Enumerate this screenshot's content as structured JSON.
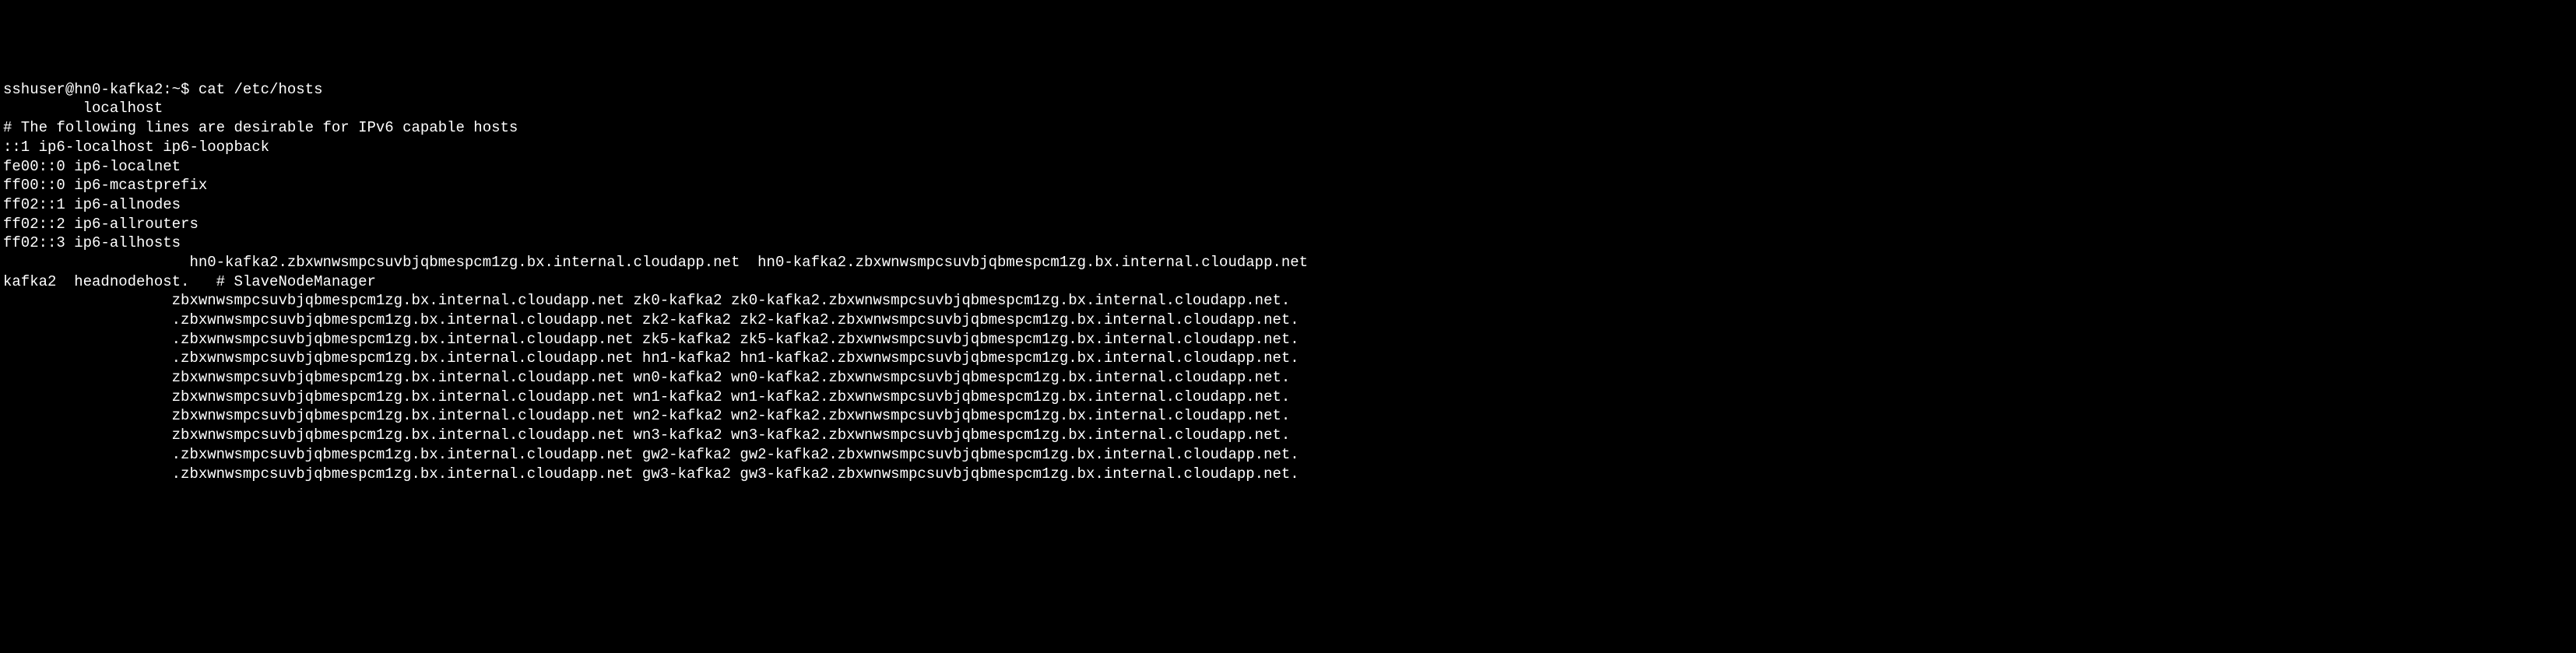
{
  "terminal": {
    "prompt": "sshuser@hn0-kafka2:~$ cat /etc/hosts",
    "lines": [
      "sshuser@hn0-kafka2:~$ cat /etc/hosts",
      "         localhost",
      "",
      "# The following lines are desirable for IPv6 capable hosts",
      "::1 ip6-localhost ip6-loopback",
      "fe00::0 ip6-localnet",
      "ff00::0 ip6-mcastprefix",
      "ff02::1 ip6-allnodes",
      "ff02::2 ip6-allrouters",
      "ff02::3 ip6-allhosts",
      "                     hn0-kafka2.zbxwnwsmpcsuvbjqbmespcm1zg.bx.internal.cloudapp.net  hn0-kafka2.zbxwnwsmpcsuvbjqbmespcm1zg.bx.internal.cloudapp.net",
      "kafka2  headnodehost.   # SlaveNodeManager",
      "                   zbxwnwsmpcsuvbjqbmespcm1zg.bx.internal.cloudapp.net zk0-kafka2 zk0-kafka2.zbxwnwsmpcsuvbjqbmespcm1zg.bx.internal.cloudapp.net.",
      "                   .zbxwnwsmpcsuvbjqbmespcm1zg.bx.internal.cloudapp.net zk2-kafka2 zk2-kafka2.zbxwnwsmpcsuvbjqbmespcm1zg.bx.internal.cloudapp.net.",
      "                   .zbxwnwsmpcsuvbjqbmespcm1zg.bx.internal.cloudapp.net zk5-kafka2 zk5-kafka2.zbxwnwsmpcsuvbjqbmespcm1zg.bx.internal.cloudapp.net.",
      "                   .zbxwnwsmpcsuvbjqbmespcm1zg.bx.internal.cloudapp.net hn1-kafka2 hn1-kafka2.zbxwnwsmpcsuvbjqbmespcm1zg.bx.internal.cloudapp.net.",
      "                   zbxwnwsmpcsuvbjqbmespcm1zg.bx.internal.cloudapp.net wn0-kafka2 wn0-kafka2.zbxwnwsmpcsuvbjqbmespcm1zg.bx.internal.cloudapp.net.",
      "                   zbxwnwsmpcsuvbjqbmespcm1zg.bx.internal.cloudapp.net wn1-kafka2 wn1-kafka2.zbxwnwsmpcsuvbjqbmespcm1zg.bx.internal.cloudapp.net.",
      "                   zbxwnwsmpcsuvbjqbmespcm1zg.bx.internal.cloudapp.net wn2-kafka2 wn2-kafka2.zbxwnwsmpcsuvbjqbmespcm1zg.bx.internal.cloudapp.net.",
      "                   zbxwnwsmpcsuvbjqbmespcm1zg.bx.internal.cloudapp.net wn3-kafka2 wn3-kafka2.zbxwnwsmpcsuvbjqbmespcm1zg.bx.internal.cloudapp.net.",
      "                   .zbxwnwsmpcsuvbjqbmespcm1zg.bx.internal.cloudapp.net gw2-kafka2 gw2-kafka2.zbxwnwsmpcsuvbjqbmespcm1zg.bx.internal.cloudapp.net.",
      "                   .zbxwnwsmpcsuvbjqbmespcm1zg.bx.internal.cloudapp.net gw3-kafka2 gw3-kafka2.zbxwnwsmpcsuvbjqbmespcm1zg.bx.internal.cloudapp.net."
    ]
  }
}
